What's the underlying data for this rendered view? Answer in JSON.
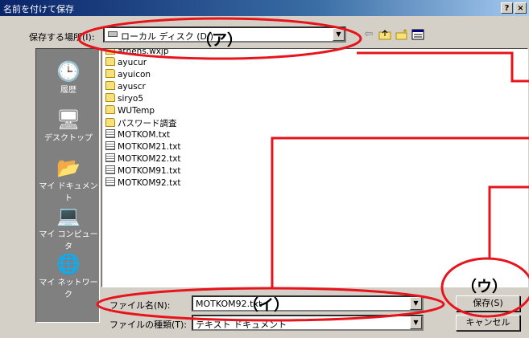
{
  "window": {
    "title": "名前を付けて保存",
    "help_button": "?",
    "close_button": "×"
  },
  "location": {
    "label": "保存する場所(I):",
    "value": "ローカル ディスク (D:)"
  },
  "toolbar": {
    "icons": [
      "back-icon",
      "up-folder-icon",
      "new-folder-icon",
      "view-menu-icon"
    ]
  },
  "places_bar": {
    "items": [
      {
        "label": "履歴",
        "icon": "history-icon"
      },
      {
        "label": "デスクトップ",
        "icon": "desktop-icon"
      },
      {
        "label": "マイ ドキュメント",
        "icon": "my-documents-icon"
      },
      {
        "label": "マイ コンピュータ",
        "icon": "my-computer-icon"
      },
      {
        "label": "マイ ネットワーク",
        "icon": "my-network-icon"
      }
    ]
  },
  "files": [
    {
      "name": "athens.wxjp",
      "type": "folder"
    },
    {
      "name": "ayucur",
      "type": "folder"
    },
    {
      "name": "ayuicon",
      "type": "folder"
    },
    {
      "name": "ayuscr",
      "type": "folder"
    },
    {
      "name": "siryo5",
      "type": "folder"
    },
    {
      "name": "WUTemp",
      "type": "folder"
    },
    {
      "name": "パスワード調査",
      "type": "folder"
    },
    {
      "name": "MOTKOM.txt",
      "type": "text"
    },
    {
      "name": "MOTKOM21.txt",
      "type": "text"
    },
    {
      "name": "MOTKOM22.txt",
      "type": "text"
    },
    {
      "name": "MOTKOM91.txt",
      "type": "text"
    },
    {
      "name": "MOTKOM92.txt",
      "type": "text"
    }
  ],
  "filename": {
    "label": "ファイル名(N):",
    "value": "MOTKOM92.txt"
  },
  "filetype": {
    "label": "ファイルの種類(T):",
    "value": "テキスト ドキュメント"
  },
  "buttons": {
    "save": "保存(S)",
    "cancel": "キャンセル"
  },
  "annotations": {
    "a": "（ア）",
    "i": "（イ）",
    "u": "（ウ）"
  },
  "colors": {
    "annotation_red": "#e8141c",
    "titlebar": "#0a246a",
    "face": "#d4d0c8"
  }
}
